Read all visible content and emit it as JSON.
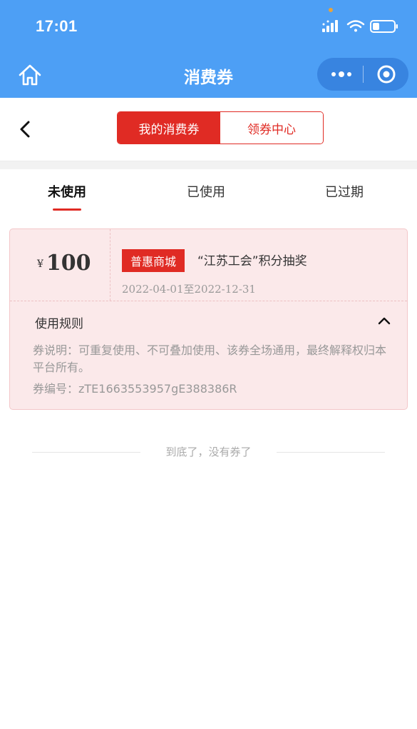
{
  "status": {
    "time": "17:01"
  },
  "nav": {
    "title": "消费券"
  },
  "segment": {
    "tabs": [
      "我的消费券",
      "领券中心"
    ]
  },
  "tabs": [
    "未使用",
    "已使用",
    "已过期"
  ],
  "coupon": {
    "currency": "¥",
    "amount": "100",
    "tag": "普惠商城",
    "title": "“江苏工会”积分抽奖",
    "dates": "2022-04-01至2022-12-31",
    "rules_title": "使用规则",
    "description": "券说明：可重复使用、不可叠加使用、该券全场通用，最终解释权归本平台所有。",
    "code": "券编号：zTE1663553957gE388386R"
  },
  "footer": {
    "text": "到底了，没有券了"
  },
  "colors": {
    "primary_blue": "#4d9ff5",
    "accent_red": "#e02b24",
    "coupon_bg": "#fbe9ea"
  }
}
